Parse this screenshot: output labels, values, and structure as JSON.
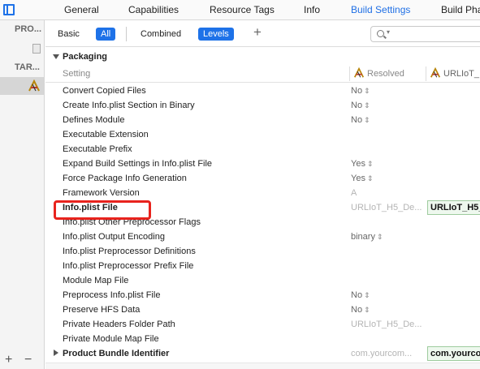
{
  "tabs": [
    {
      "label": "General"
    },
    {
      "label": "Capabilities"
    },
    {
      "label": "Resource Tags"
    },
    {
      "label": "Info"
    },
    {
      "label": "Build Settings",
      "active": true
    },
    {
      "label": "Build Pha"
    }
  ],
  "sidebar": {
    "project_header": "PRO...",
    "targets_header": "TAR..."
  },
  "filter": {
    "basic": "Basic",
    "all": "All",
    "combined": "Combined",
    "levels": "Levels"
  },
  "section": {
    "title": "Packaging"
  },
  "columns": {
    "setting": "Setting",
    "resolved": "Resolved",
    "target": "URLIoT_"
  },
  "rows": [
    {
      "name": "Convert Copied Files",
      "value": "No"
    },
    {
      "name": "Create Info.plist Section in Binary",
      "value": "No"
    },
    {
      "name": "Defines Module",
      "value": "No"
    },
    {
      "name": "Executable Extension",
      "value": ""
    },
    {
      "name": "Executable Prefix",
      "value": ""
    },
    {
      "name": "Expand Build Settings in Info.plist File",
      "value": "Yes"
    },
    {
      "name": "Force Package Info Generation",
      "value": "Yes"
    },
    {
      "name": "Framework Version",
      "value": "A"
    },
    {
      "name": "Info.plist File",
      "value": "URLIoT_H5_De...",
      "target_value": "URLIoT_H5_"
    },
    {
      "name": "Info.plist Other Preprocessor Flags",
      "value": ""
    },
    {
      "name": "Info.plist Output Encoding",
      "value": "binary"
    },
    {
      "name": "Info.plist Preprocessor Definitions",
      "value": ""
    },
    {
      "name": "Info.plist Preprocessor Prefix File",
      "value": ""
    },
    {
      "name": "Module Map File",
      "value": ""
    },
    {
      "name": "Preprocess Info.plist File",
      "value": "No"
    },
    {
      "name": "Preserve HFS Data",
      "value": "No"
    },
    {
      "name": "Private Headers Folder Path",
      "value": "URLIoT_H5_De..."
    },
    {
      "name": "Private Module Map File",
      "value": ""
    },
    {
      "name": "Product Bundle Identifier",
      "value": "com.yourcom...",
      "target_value": "com.yourco"
    }
  ],
  "colors": {
    "accent": "#1e72e8",
    "highlight": "#e8231d",
    "set_value_bg": "#eef8ee"
  }
}
